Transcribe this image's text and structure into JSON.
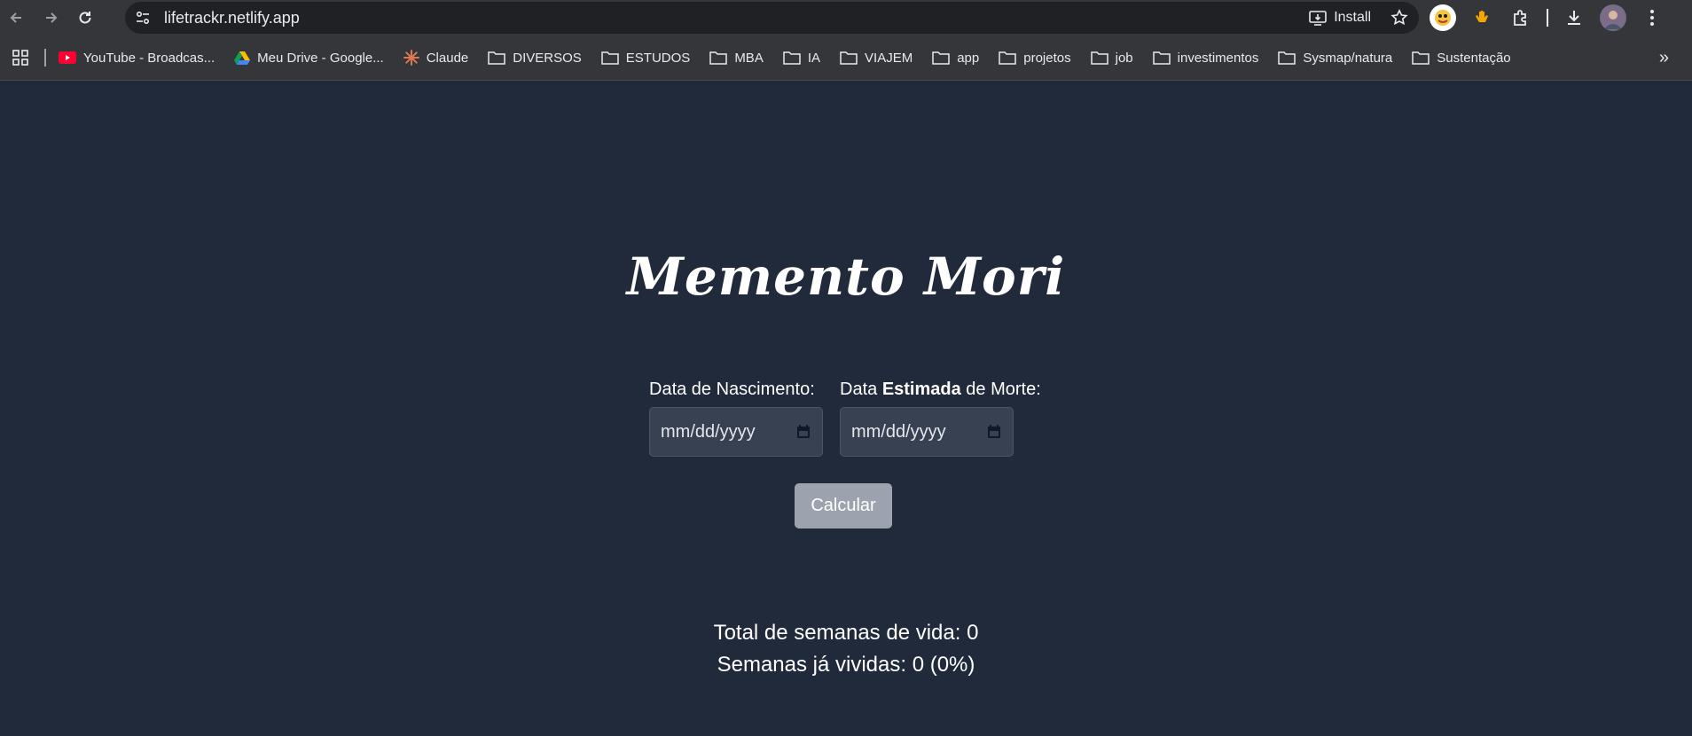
{
  "browser": {
    "url": "lifetrackr.netlify.app",
    "install_label": "Install"
  },
  "bookmarks": [
    {
      "label": "YouTube - Broadcas...",
      "icon": "youtube-icon"
    },
    {
      "label": "Meu Drive - Google...",
      "icon": "drive-icon"
    },
    {
      "label": "Claude",
      "icon": "claude-icon"
    },
    {
      "label": "DIVERSOS",
      "icon": "folder-icon"
    },
    {
      "label": "ESTUDOS",
      "icon": "folder-icon"
    },
    {
      "label": "MBA",
      "icon": "folder-icon"
    },
    {
      "label": "IA",
      "icon": "folder-icon"
    },
    {
      "label": "VIAJEM",
      "icon": "folder-icon"
    },
    {
      "label": "app",
      "icon": "folder-icon"
    },
    {
      "label": "projetos",
      "icon": "folder-icon"
    },
    {
      "label": "job",
      "icon": "folder-icon"
    },
    {
      "label": "investimentos",
      "icon": "folder-icon"
    },
    {
      "label": "Sysmap/natura",
      "icon": "folder-icon"
    },
    {
      "label": "Sustentação",
      "icon": "folder-icon"
    }
  ],
  "page": {
    "title": "Memento Mori",
    "birth_label": "Data de Nascimento:",
    "death_label_prefix": "Data ",
    "death_label_bold": "Estimada",
    "death_label_suffix": " de Morte:",
    "date_placeholder": "mm/dd/yyyy",
    "calculate_label": "Calcular",
    "total_weeks": "Total de semanas de vida: 0",
    "lived_weeks": "Semanas já vividas: 0 (0%)"
  },
  "colors": {
    "page_bg": "#202a3a",
    "input_bg": "#374151",
    "button_bg": "#9ca3af"
  }
}
